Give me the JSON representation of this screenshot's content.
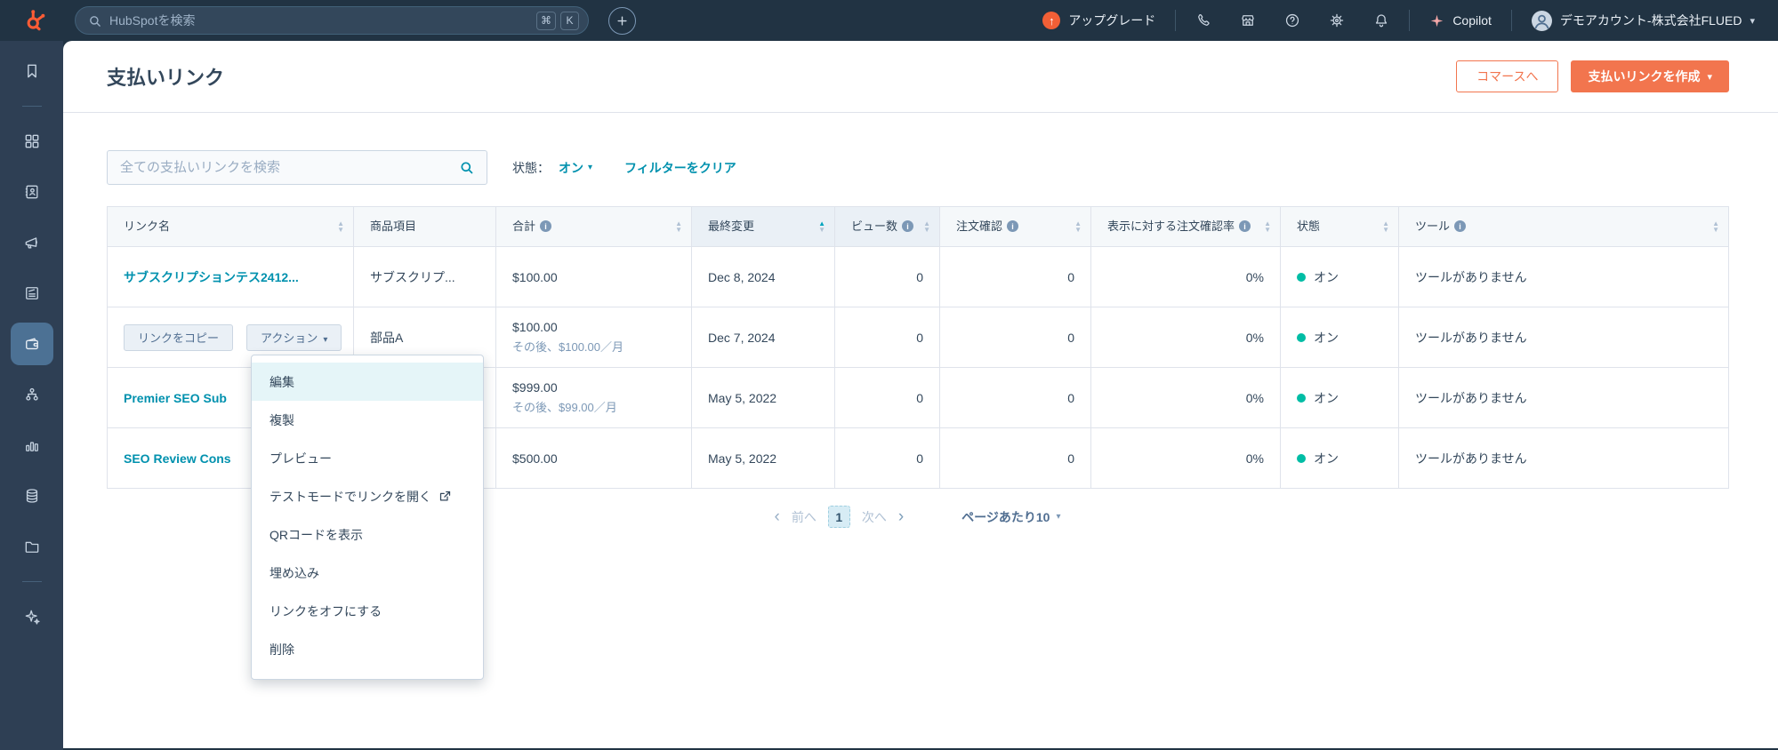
{
  "topbar": {
    "search_placeholder": "HubSpotを検索",
    "shortcut_cmd": "⌘",
    "shortcut_k": "K",
    "upgrade_label": "アップグレード",
    "copilot_label": "Copilot",
    "account_label": "デモアカウント-株式会社FLUED"
  },
  "page": {
    "title": "支払いリンク",
    "actions": {
      "commerce": "コマースへ",
      "create": "支払いリンクを作成"
    },
    "filters": {
      "search_placeholder": "全ての支払いリンクを検索",
      "status_label": "状態：",
      "status_value": "オン",
      "clear": "フィルターをクリア"
    },
    "table": {
      "columns": {
        "link": "リンク名",
        "product": "商品項目",
        "total": "合計",
        "modified": "最終変更",
        "views": "ビュー数",
        "orders": "注文確認",
        "rate": "表示に対する注文確認率",
        "status": "状態",
        "tools": "ツール"
      },
      "rows": [
        {
          "name": "サブスクリプションテス2412...",
          "product": "サブスクリプ...",
          "total": "$100.00",
          "modified": "Dec 8, 2024",
          "views": "0",
          "orders": "0",
          "rate": "0%",
          "status": "オン",
          "tools": "ツールがありません"
        },
        {
          "copy_button": "リンクをコピー",
          "actions_button": "アクション",
          "product": "部品A",
          "total": "$100.00",
          "total_sub": "その後、$100.00／月",
          "modified": "Dec 7, 2024",
          "views": "0",
          "orders": "0",
          "rate": "0%",
          "status": "オン",
          "tools": "ツールがありません"
        },
        {
          "name": "Premier SEO Sub",
          "product": "",
          "total": "$999.00",
          "total_sub": "その後、$99.00／月",
          "modified": "May 5, 2022",
          "views": "0",
          "orders": "0",
          "rate": "0%",
          "status": "オン",
          "tools": "ツールがありません"
        },
        {
          "name": "SEO Review Cons",
          "product": "",
          "total": "$500.00",
          "modified": "May 5, 2022",
          "views": "0",
          "orders": "0",
          "rate": "0%",
          "status": "オン",
          "tools": "ツールがありません"
        }
      ]
    },
    "menu": {
      "items": [
        "編集",
        "複製",
        "プレビュー",
        "テストモードでリンクを開く",
        "QRコードを表示",
        "埋め込み",
        "リンクをオフにする",
        "削除"
      ]
    },
    "pagination": {
      "prev": "前へ",
      "page": "1",
      "next": "次へ",
      "page_size": "ページあたり10"
    }
  },
  "colors": {
    "accent_orange": "#f2754e",
    "link_teal": "#0091ae",
    "status_green": "#00bda5",
    "topbar_bg": "#213343",
    "sidebar_bg": "#2e3f54",
    "sidebar_active": "#4c7194"
  }
}
